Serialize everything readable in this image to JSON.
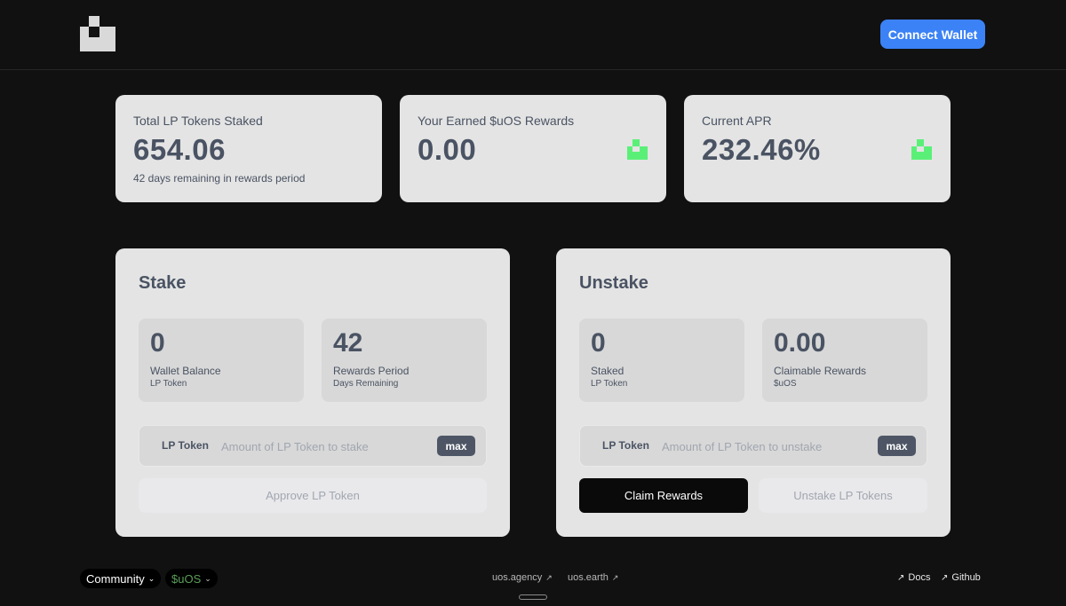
{
  "header": {
    "logo_icon": "uos-logo-icon",
    "connect_label": "Connect Wallet",
    "connect_color": "#3b82f6"
  },
  "stats": {
    "total_staked": {
      "label": "Total LP Tokens Staked",
      "value": "654.06",
      "sub": "42 days remaining in rewards period"
    },
    "earned": {
      "label": "Your Earned $uOS Rewards",
      "value": "0.00",
      "icon": "uos-logo-icon",
      "icon_color": "#5af078"
    },
    "apr": {
      "label": "Current APR",
      "value": "232.46%",
      "icon": "uos-logo-icon",
      "icon_color": "#5af078"
    }
  },
  "stake": {
    "title": "Stake",
    "wallet": {
      "value": "0",
      "label": "Wallet Balance",
      "sub": "LP Token"
    },
    "period": {
      "value": "42",
      "label": "Rewards Period",
      "sub": "Days Remaining"
    },
    "input": {
      "prefix": "LP Token",
      "value": "",
      "placeholder": "Amount of LP Token to stake",
      "max_label": "max"
    },
    "approve_label": "Approve LP Token"
  },
  "unstake": {
    "title": "Unstake",
    "staked": {
      "value": "0",
      "label": "Staked",
      "sub": "LP Token"
    },
    "claimable": {
      "value": "0.00",
      "label": "Claimable Rewards",
      "sub": "$uOS"
    },
    "input": {
      "prefix": "LP Token",
      "value": "",
      "placeholder": "Amount of LP Token to unstake",
      "max_label": "max"
    },
    "claim_label": "Claim Rewards",
    "unstake_label": "Unstake LP Tokens"
  },
  "footer": {
    "community_label": "Community",
    "token_label": "$uOS",
    "token_color": "#5a9e5a",
    "links": [
      "uos.agency",
      "uos.earth"
    ],
    "docs_label": "Docs",
    "github_label": "Github"
  }
}
